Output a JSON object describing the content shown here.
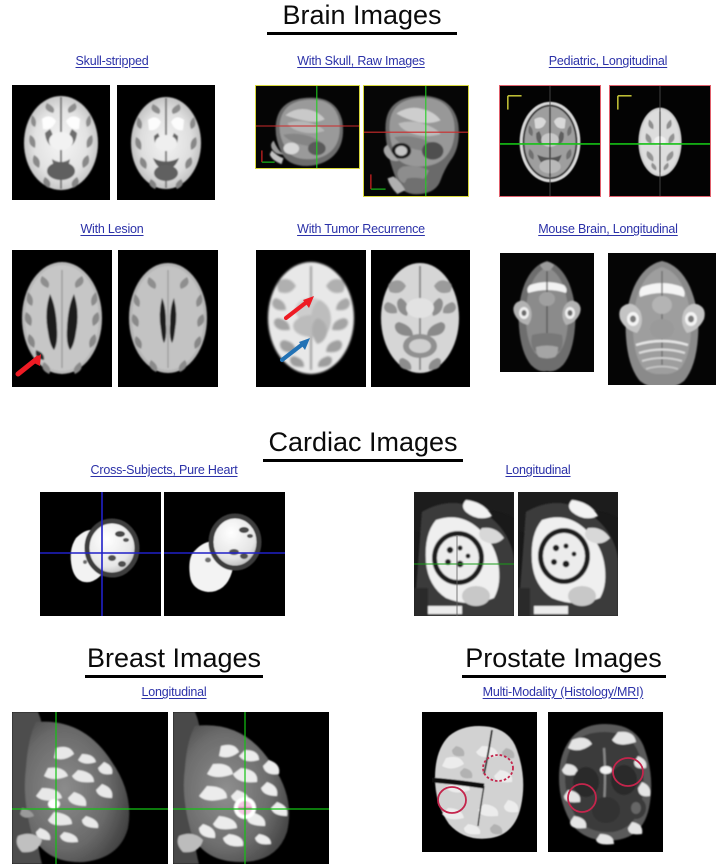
{
  "figure": {
    "kind": "medical-imaging-figure",
    "background": "#ffffff",
    "link_color": "#2b31a8",
    "title_color": "#0b0b0b"
  },
  "sections": [
    {
      "id": "brain",
      "title": "Brain Images",
      "groups": [
        {
          "id": "skull-stripped",
          "label": "Skull-stripped"
        },
        {
          "id": "with-skull",
          "label": "With Skull, Raw Images"
        },
        {
          "id": "pediatric",
          "label": "Pediatric, Longitudinal"
        },
        {
          "id": "with-lesion",
          "label": "With Lesion"
        },
        {
          "id": "tumor-recurrence",
          "label": "With Tumor Recurrence"
        },
        {
          "id": "mouse-brain",
          "label": "Mouse Brain, Longitudinal"
        }
      ]
    },
    {
      "id": "cardiac",
      "title": "Cardiac Images",
      "groups": [
        {
          "id": "cross-subjects",
          "label": "Cross-Subjects, Pure Heart"
        },
        {
          "id": "cardiac-long",
          "label": "Longitudinal"
        }
      ]
    },
    {
      "id": "breast",
      "title": "Breast Images",
      "groups": [
        {
          "id": "breast-long",
          "label": "Longitudinal"
        }
      ]
    },
    {
      "id": "prostate",
      "title": "Prostate Images",
      "groups": [
        {
          "id": "prostate-multimodal",
          "label": "Multi-Modality (Histology/MRI)"
        }
      ]
    }
  ],
  "annotations": {
    "lesion_arrow_color": "#ee1b24",
    "tumor_arrow_red": "#ee1b24",
    "tumor_arrow_blue": "#2272b5",
    "crosshair_green": "#13c413",
    "crosshair_blue": "#2020c8",
    "crosshair_red": "#d02020",
    "roi_circle_color": "#c4254c",
    "axis_marker_yellow": "#d9d93c",
    "axis_marker_green": "#18b018",
    "axis_marker_red": "#cc2222"
  },
  "panels": {
    "skull_stripped": [
      "axial-brain-mri-skull-stripped-1",
      "axial-brain-mri-skull-stripped-2"
    ],
    "with_skull": [
      "sagittal-head-mri-crosshair-1",
      "sagittal-head-mri-crosshair-2"
    ],
    "pediatric": [
      "axial-pediatric-brain-mri-1",
      "axial-pediatric-brain-mri-2"
    ],
    "with_lesion": [
      "axial-brain-mri-lesion-arrow",
      "axial-brain-mri-lesion-followup"
    ],
    "tumor_recurrence": [
      "axial-brain-mri-tumor-arrows",
      "axial-brain-mri-tumor-followup"
    ],
    "mouse_brain": [
      "axial-mouse-brain-mri-1",
      "axial-mouse-brain-mri-2"
    ],
    "cardiac_cross": [
      "3d-heart-surface-crosshair-1",
      "3d-heart-surface-crosshair-2"
    ],
    "cardiac_long": [
      "cardiac-mri-short-axis-1",
      "cardiac-mri-short-axis-2"
    ],
    "breast": [
      "breast-mri-sagittal-crosshair-1",
      "breast-mri-sagittal-crosshair-2"
    ],
    "prostate": [
      "prostate-histology-slice",
      "prostate-mri-axial-slice"
    ]
  }
}
